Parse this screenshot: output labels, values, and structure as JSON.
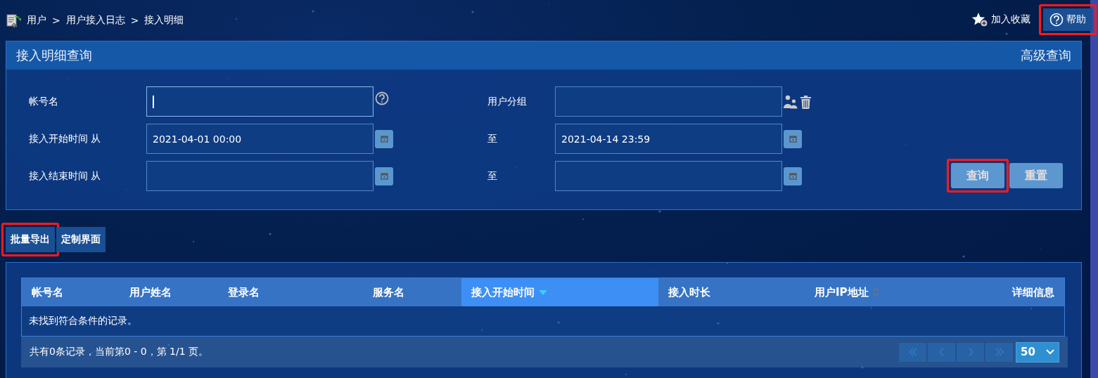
{
  "breadcrumb": [
    "用户",
    "用户接入日志",
    "接入明细"
  ],
  "breadcrumb_separator": ">",
  "top_actions": {
    "favorite": "加入收藏",
    "help": {
      "label": "帮助",
      "highlighted": true
    }
  },
  "query_panel": {
    "title": "接入明细查询",
    "advanced": "高级查询",
    "rows": [
      {
        "fields": [
          {
            "label": "帐号名",
            "focused": true,
            "kind": "help"
          },
          {
            "label": "用户分组",
            "focused": false,
            "kind": "group"
          }
        ]
      },
      {
        "fields": [
          {
            "label": "接入开始时间 从",
            "value": "2021-04-01 00:00",
            "focused": false,
            "kind": "calendar"
          },
          {
            "label": "至",
            "value": "2021-04-14 23:59",
            "focused": false,
            "kind": "calendar"
          }
        ]
      },
      {
        "fields": [
          {
            "label": "接入结束时间 从",
            "focused": false,
            "kind": "calendar"
          },
          {
            "label": "至",
            "focused": false,
            "kind": "calendar"
          }
        ]
      }
    ],
    "buttons": [
      {
        "label": "查询",
        "highlighted": true
      },
      {
        "label": "重置",
        "highlighted": false
      }
    ]
  },
  "toolbar": [
    {
      "label": "批量导出",
      "highlighted": true
    },
    {
      "label": "定制界面",
      "highlighted": false
    }
  ],
  "table": {
    "columns": [
      {
        "label": "帐号名",
        "selected": false,
        "sorted": false,
        "sortable": false
      },
      {
        "label": "用户姓名",
        "selected": false,
        "sorted": false,
        "sortable": false
      },
      {
        "label": "登录名",
        "selected": false,
        "sorted": false,
        "sortable": false
      },
      {
        "label": "服务名",
        "selected": false,
        "sorted": false,
        "sortable": false
      },
      {
        "label": "接入开始时间",
        "selected": true,
        "sorted": true,
        "sortable": true
      },
      {
        "label": "接入时长",
        "selected": false,
        "sorted": false,
        "sortable": false
      },
      {
        "label": "用户IP地址",
        "selected": false,
        "sorted": false,
        "sortable": true
      },
      {
        "label": "详细信息",
        "selected": false,
        "sorted": false,
        "sortable": false
      }
    ],
    "empty_message": "未找到符合条件的记录。",
    "summary": "共有0条记录，当前第0 - 0，第 1/1 页。",
    "page_size": "50"
  }
}
